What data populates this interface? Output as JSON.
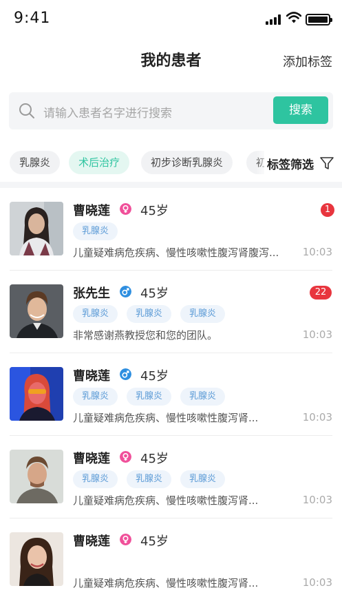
{
  "status_bar": {
    "time": "9:41"
  },
  "header": {
    "title": "我的患者",
    "action": "添加标签"
  },
  "search": {
    "placeholder": "请输入患者名字进行搜索",
    "button": "搜索"
  },
  "filters": {
    "chips": [
      "乳腺炎",
      "术后治疗",
      "初步诊断乳腺炎",
      "初"
    ],
    "active_index": 1,
    "filter_label": "标签筛选"
  },
  "colors": {
    "accent": "#2ec4a0",
    "female": "#f0509a",
    "male": "#2f8fe0",
    "badge": "#e8353e",
    "tag_text": "#5a9ad6"
  },
  "patients": [
    {
      "name": "曹晓莲",
      "gender": "female",
      "age": "45岁",
      "badge": "1",
      "tags": [
        "乳腺炎"
      ],
      "snippet": "儿童疑难病危疾病、慢性咳嗽性腹泻肾腹泻...",
      "time": "10:03"
    },
    {
      "name": "张先生",
      "gender": "male",
      "age": "45岁",
      "badge": "22",
      "tags": [
        "乳腺炎",
        "乳腺炎",
        "乳腺炎"
      ],
      "snippet": "非常感谢燕教授您和您的团队。",
      "time": "10:03"
    },
    {
      "name": "曹晓莲",
      "gender": "male",
      "age": "45岁",
      "badge": "",
      "tags": [
        "乳腺炎",
        "乳腺炎",
        "乳腺炎"
      ],
      "snippet": "儿童疑难病危疾病、慢性咳嗽性腹泻肾...",
      "time": "10:03"
    },
    {
      "name": "曹晓莲",
      "gender": "female",
      "age": "45岁",
      "badge": "",
      "tags": [
        "乳腺炎",
        "乳腺炎",
        "乳腺炎"
      ],
      "snippet": "儿童疑难病危疾病、慢性咳嗽性腹泻肾...",
      "time": "10:03"
    },
    {
      "name": "曹晓莲",
      "gender": "female",
      "age": "45岁",
      "badge": "",
      "tags": [],
      "snippet": "儿童疑难病危疾病、慢性咳嗽性腹泻肾...",
      "time": "10:03"
    }
  ]
}
